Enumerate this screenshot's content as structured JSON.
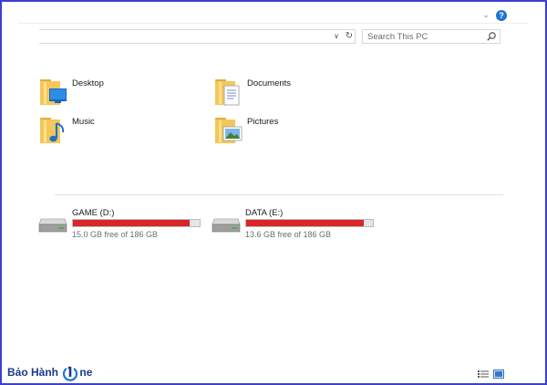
{
  "search": {
    "placeholder": "Search This PC"
  },
  "folders": [
    {
      "label": "Desktop"
    },
    {
      "label": "Documents"
    },
    {
      "label": "Music"
    },
    {
      "label": "Pictures"
    }
  ],
  "drives": [
    {
      "name": "GAME (D:)",
      "free_text": "15.0 GB free of 186 GB",
      "used_fraction": 0.919
    },
    {
      "name": "DATA (E:)",
      "free_text": "13.6 GB free of 186 GB",
      "used_fraction": 0.927
    }
  ],
  "watermark": {
    "text": "Bảo Hành",
    "suffix": "ne"
  },
  "colors": {
    "frame": "#3b3fd1",
    "usage_bar": "#da2626",
    "help": "#1f74d1",
    "folder": "#f4c75a",
    "brand": "#1b3a8c"
  },
  "icons": {
    "help": "question-circle-icon",
    "refresh": "refresh-icon",
    "search": "magnifier-icon"
  }
}
